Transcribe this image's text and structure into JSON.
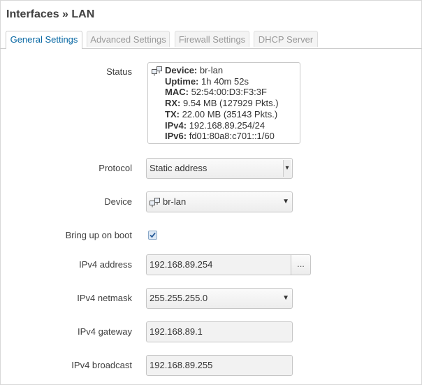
{
  "page": {
    "title": "Interfaces » LAN"
  },
  "tabs": [
    {
      "label": "General Settings",
      "active": true
    },
    {
      "label": "Advanced Settings",
      "active": false
    },
    {
      "label": "Firewall Settings",
      "active": false
    },
    {
      "label": "DHCP Server",
      "active": false
    }
  ],
  "status": {
    "label": "Status",
    "icon": "network-bridge-icon",
    "device_key": "Device:",
    "device_val": "br-lan",
    "uptime_key": "Uptime:",
    "uptime_val": "1h 40m 52s",
    "mac_key": "MAC:",
    "mac_val": "52:54:00:D3:F3:3F",
    "rx_key": "RX:",
    "rx_val": "9.54 MB (127929 Pkts.)",
    "tx_key": "TX:",
    "tx_val": "22.00 MB (35143 Pkts.)",
    "ipv4_key": "IPv4:",
    "ipv4_val": "192.168.89.254/24",
    "ipv6_key": "IPv6:",
    "ipv6_val": "fd01:80a8:c701::1/60"
  },
  "protocol": {
    "label": "Protocol",
    "value": "Static address"
  },
  "device": {
    "label": "Device",
    "value": "br-lan",
    "icon": "network-bridge-icon"
  },
  "boot": {
    "label": "Bring up on boot",
    "checked": true
  },
  "ipv4_address": {
    "label": "IPv4 address",
    "value": "192.168.89.254",
    "button": "..."
  },
  "ipv4_netmask": {
    "label": "IPv4 netmask",
    "value": "255.255.255.0"
  },
  "ipv4_gateway": {
    "label": "IPv4 gateway",
    "value": "192.168.89.1"
  },
  "ipv4_broadcast": {
    "label": "IPv4 broadcast",
    "value": "192.168.89.255"
  },
  "colors": {
    "accent": "#0a69a4",
    "border": "#c6c6c6"
  }
}
